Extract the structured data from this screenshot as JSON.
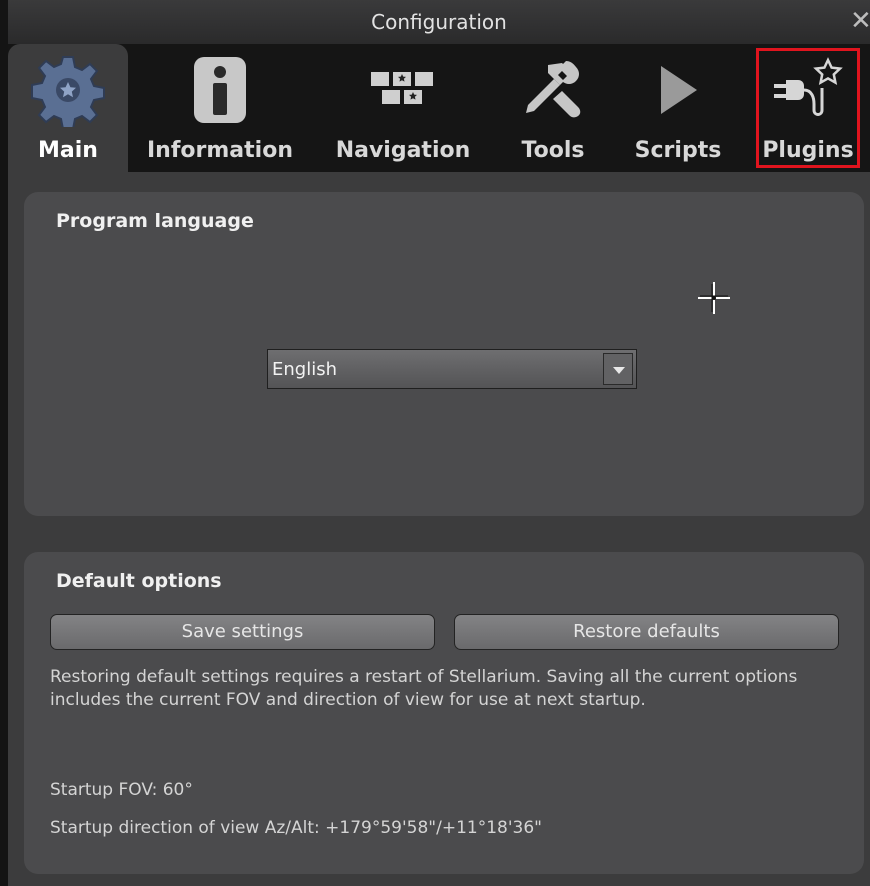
{
  "window": {
    "title": "Configuration",
    "close_glyph": "✕"
  },
  "tabs": [
    {
      "label": "Main",
      "icon": "gear-icon",
      "active": true
    },
    {
      "label": "Information",
      "icon": "info-icon",
      "active": false
    },
    {
      "label": "Navigation",
      "icon": "navigation-keys-icon",
      "active": false
    },
    {
      "label": "Tools",
      "icon": "tools-icon",
      "active": false
    },
    {
      "label": "Scripts",
      "icon": "play-icon",
      "active": false
    },
    {
      "label": "Plugins",
      "icon": "plug-star-icon",
      "active": false
    }
  ],
  "program_language": {
    "title": "Program language",
    "selected": "English"
  },
  "default_options": {
    "title": "Default options",
    "save_label": "Save settings",
    "restore_label": "Restore defaults",
    "info": "Restoring default settings requires a restart of Stellarium. Saving all the current options includes the current FOV and direction of view for use at next startup.",
    "startup_fov": "Startup FOV: 60°",
    "startup_direction": "Startup direction of view Az/Alt: +179°59'58\"/+11°18'36\""
  },
  "colors": {
    "highlight": "#e0141e",
    "panel": "#4b4b4d",
    "tabbar": "#151515"
  }
}
